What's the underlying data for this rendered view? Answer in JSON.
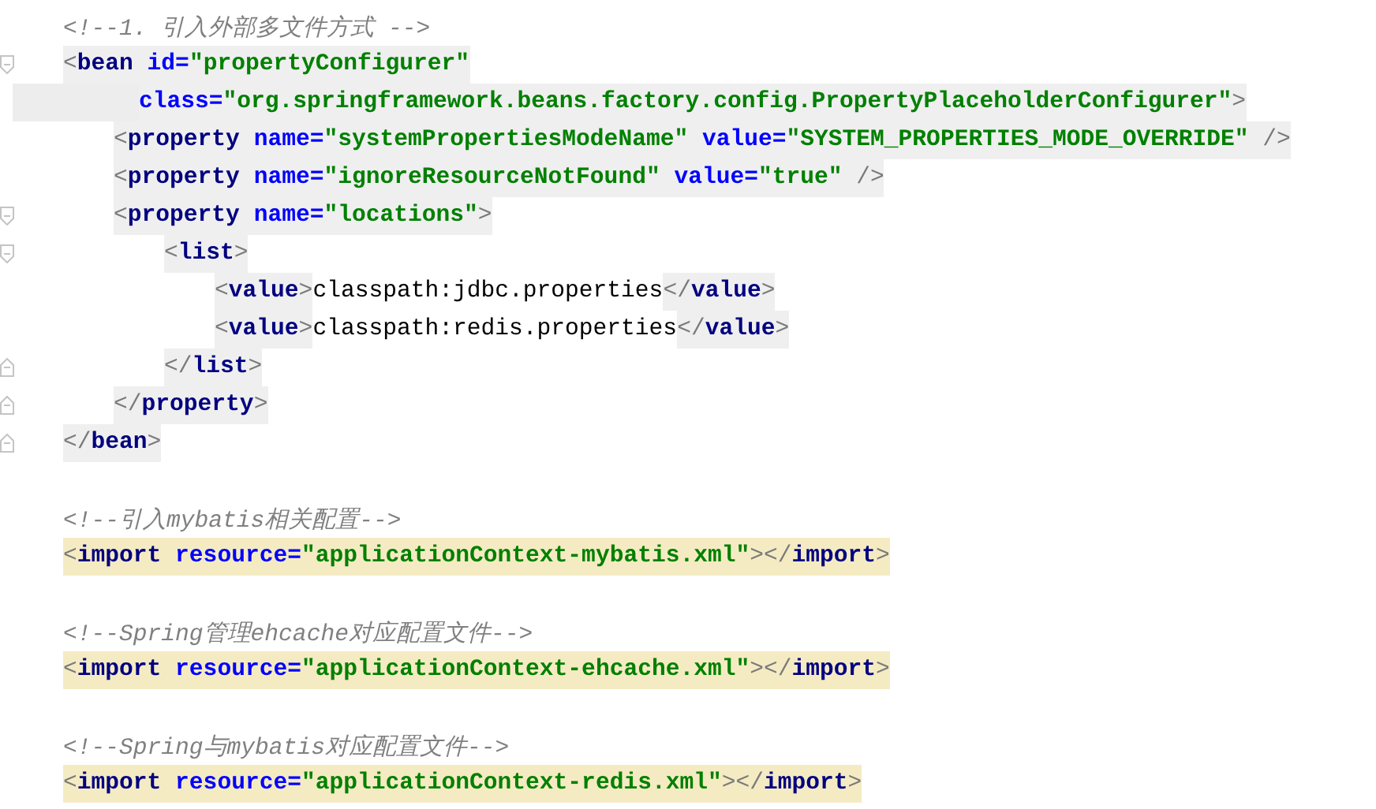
{
  "editor": {
    "lines": [
      {
        "kind": "plain",
        "current": false,
        "segments": [
          {
            "kind": "plain",
            "tokens": [
              {
                "kind": "comment",
                "t": "<!--1. 引入外部多文件方式 -->"
              }
            ]
          }
        ]
      },
      {
        "kind": "open_tag",
        "current": false,
        "segments": [
          {
            "kind": "tag",
            "tokens": [
              {
                "kind": "punct",
                "t": "<"
              },
              {
                "kind": "tag",
                "t": "bean"
              },
              {
                "kind": "attr",
                "t": " id="
              },
              {
                "kind": "string",
                "t": "\"propertyConfigurer\""
              }
            ]
          }
        ],
        "children": [
          {
            "kind": "continuation",
            "current": true,
            "segments": [
              {
                "kind": "tag",
                "tokens": [
                  {
                    "kind": "attr",
                    "t": "class="
                  },
                  {
                    "kind": "string",
                    "t": "\"org.springframework.beans.factory.config.PropertyPlaceholderConfigurer\""
                  },
                  {
                    "kind": "punct",
                    "t": ">"
                  }
                ]
              }
            ]
          },
          {
            "kind": "plain",
            "current": false,
            "segments": [
              {
                "kind": "tag",
                "tokens": [
                  {
                    "kind": "punct",
                    "t": "<"
                  },
                  {
                    "kind": "tag",
                    "t": "property"
                  },
                  {
                    "kind": "attr",
                    "t": " name="
                  },
                  {
                    "kind": "string",
                    "t": "\"systemPropertiesModeName\""
                  },
                  {
                    "kind": "attr",
                    "t": " value="
                  },
                  {
                    "kind": "string",
                    "t": "\"SYSTEM_PROPERTIES_MODE_OVERRIDE\""
                  },
                  {
                    "kind": "punct",
                    "t": " />"
                  }
                ]
              }
            ]
          },
          {
            "kind": "plain",
            "current": false,
            "segments": [
              {
                "kind": "tag",
                "tokens": [
                  {
                    "kind": "punct",
                    "t": "<"
                  },
                  {
                    "kind": "tag",
                    "t": "property"
                  },
                  {
                    "kind": "attr",
                    "t": " name="
                  },
                  {
                    "kind": "string",
                    "t": "\"ignoreResourceNotFound\""
                  },
                  {
                    "kind": "attr",
                    "t": " value="
                  },
                  {
                    "kind": "string",
                    "t": "\"true\""
                  },
                  {
                    "kind": "punct",
                    "t": " />"
                  }
                ]
              }
            ]
          },
          {
            "kind": "open_tag",
            "current": false,
            "segments": [
              {
                "kind": "tag",
                "tokens": [
                  {
                    "kind": "punct",
                    "t": "<"
                  },
                  {
                    "kind": "tag",
                    "t": "property"
                  },
                  {
                    "kind": "attr",
                    "t": " name="
                  },
                  {
                    "kind": "string",
                    "t": "\"locations\""
                  },
                  {
                    "kind": "punct",
                    "t": ">"
                  }
                ]
              }
            ],
            "children": [
              {
                "kind": "open_tag",
                "current": false,
                "segments": [
                  {
                    "kind": "tag",
                    "tokens": [
                      {
                        "kind": "punct",
                        "t": "<"
                      },
                      {
                        "kind": "tag",
                        "t": "list"
                      },
                      {
                        "kind": "punct",
                        "t": ">"
                      }
                    ]
                  }
                ],
                "children": [
                  {
                    "kind": "plain",
                    "current": false,
                    "segments": [
                      {
                        "kind": "tag",
                        "tokens": [
                          {
                            "kind": "punct",
                            "t": "<"
                          },
                          {
                            "kind": "tag",
                            "t": "value"
                          },
                          {
                            "kind": "punct",
                            "t": ">"
                          }
                        ]
                      },
                      {
                        "kind": "plain",
                        "tokens": [
                          {
                            "kind": "text",
                            "t": "classpath:jdbc.properties"
                          }
                        ]
                      },
                      {
                        "kind": "tag",
                        "tokens": [
                          {
                            "kind": "punct",
                            "t": "</"
                          },
                          {
                            "kind": "tag",
                            "t": "value"
                          },
                          {
                            "kind": "punct",
                            "t": ">"
                          }
                        ]
                      }
                    ]
                  },
                  {
                    "kind": "plain",
                    "current": false,
                    "segments": [
                      {
                        "kind": "tag",
                        "tokens": [
                          {
                            "kind": "punct",
                            "t": "<"
                          },
                          {
                            "kind": "tag",
                            "t": "value"
                          },
                          {
                            "kind": "punct",
                            "t": ">"
                          }
                        ]
                      },
                      {
                        "kind": "plain",
                        "tokens": [
                          {
                            "kind": "text",
                            "t": "classpath:redis.properties"
                          }
                        ]
                      },
                      {
                        "kind": "tag",
                        "tokens": [
                          {
                            "kind": "punct",
                            "t": "</"
                          },
                          {
                            "kind": "tag",
                            "t": "value"
                          },
                          {
                            "kind": "punct",
                            "t": ">"
                          }
                        ]
                      }
                    ]
                  }
                ]
              },
              {
                "kind": "close_tag",
                "current": false,
                "segments": [
                  {
                    "kind": "tag",
                    "tokens": [
                      {
                        "kind": "punct",
                        "t": "</"
                      },
                      {
                        "kind": "tag",
                        "t": "list"
                      },
                      {
                        "kind": "punct",
                        "t": ">"
                      }
                    ]
                  }
                ]
              }
            ]
          },
          {
            "kind": "close_tag",
            "current": false,
            "segments": [
              {
                "kind": "tag",
                "tokens": [
                  {
                    "kind": "punct",
                    "t": "</"
                  },
                  {
                    "kind": "tag",
                    "t": "property"
                  },
                  {
                    "kind": "punct",
                    "t": ">"
                  }
                ]
              }
            ]
          }
        ]
      },
      {
        "kind": "close_tag",
        "current": false,
        "segments": [
          {
            "kind": "tag",
            "tokens": [
              {
                "kind": "punct",
                "t": "</"
              },
              {
                "kind": "tag",
                "t": "bean"
              },
              {
                "kind": "punct",
                "t": ">"
              }
            ]
          }
        ]
      },
      {
        "kind": "blank"
      },
      {
        "kind": "plain",
        "current": false,
        "segments": [
          {
            "kind": "plain",
            "tokens": [
              {
                "kind": "comment",
                "t": "<!--引入mybatis相关配置-->"
              }
            ]
          }
        ]
      },
      {
        "kind": "plain",
        "current": false,
        "segments": [
          {
            "kind": "import",
            "tokens": [
              {
                "kind": "punct",
                "t": "<"
              },
              {
                "kind": "tag",
                "t": "import"
              },
              {
                "kind": "attr",
                "t": " resource="
              },
              {
                "kind": "string",
                "t": "\"applicationContext-mybatis.xml\""
              },
              {
                "kind": "punct",
                "t": "></"
              },
              {
                "kind": "tag",
                "t": "import"
              },
              {
                "kind": "punct",
                "t": ">"
              }
            ]
          }
        ]
      },
      {
        "kind": "blank"
      },
      {
        "kind": "plain",
        "current": false,
        "segments": [
          {
            "kind": "plain",
            "tokens": [
              {
                "kind": "comment",
                "t": "<!--Spring管理ehcache对应配置文件-->"
              }
            ]
          }
        ]
      },
      {
        "kind": "plain",
        "current": false,
        "segments": [
          {
            "kind": "import",
            "tokens": [
              {
                "kind": "punct",
                "t": "<"
              },
              {
                "kind": "tag",
                "t": "import"
              },
              {
                "kind": "attr",
                "t": " resource="
              },
              {
                "kind": "string",
                "t": "\"applicationContext-ehcache.xml\""
              },
              {
                "kind": "punct",
                "t": "></"
              },
              {
                "kind": "tag",
                "t": "import"
              },
              {
                "kind": "punct",
                "t": ">"
              }
            ]
          }
        ]
      },
      {
        "kind": "blank"
      },
      {
        "kind": "plain",
        "current": false,
        "segments": [
          {
            "kind": "plain",
            "tokens": [
              {
                "kind": "comment",
                "t": "<!--Spring与mybatis对应配置文件-->"
              }
            ]
          }
        ]
      },
      {
        "kind": "plain",
        "current": false,
        "segments": [
          {
            "kind": "import",
            "tokens": [
              {
                "kind": "punct",
                "t": "<"
              },
              {
                "kind": "tag",
                "t": "import"
              },
              {
                "kind": "attr",
                "t": " resource="
              },
              {
                "kind": "string",
                "t": "\"applicationContext-redis.xml\""
              },
              {
                "kind": "punct",
                "t": "></"
              },
              {
                "kind": "tag",
                "t": "import"
              },
              {
                "kind": "punct",
                "t": ">"
              }
            ]
          }
        ]
      }
    ]
  }
}
